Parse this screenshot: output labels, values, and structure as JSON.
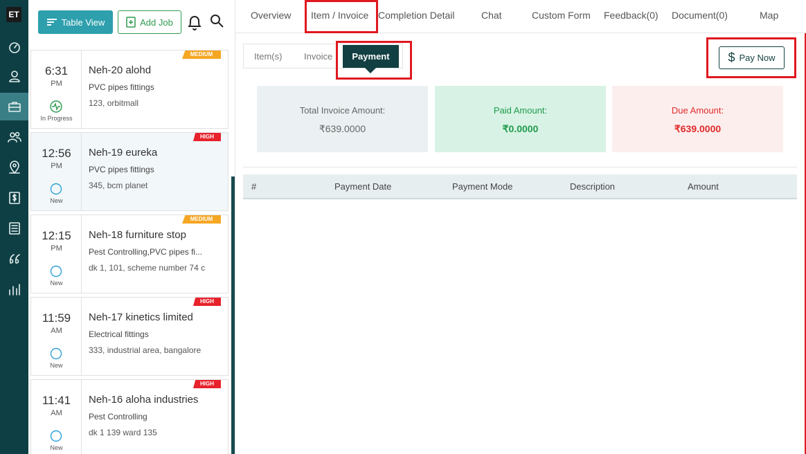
{
  "app": {
    "logo_text": "ET",
    "rail_icons": [
      "dashboard-icon",
      "user-icon",
      "briefcase-icon",
      "users-icon",
      "map-pin-icon",
      "dollar-icon",
      "list-icon",
      "quote-icon",
      "bar-chart-icon"
    ],
    "active_rail_icon": "briefcase-icon"
  },
  "toolbar": {
    "table_view_label": "Table View",
    "add_job_label": "Add Job"
  },
  "jobs": [
    {
      "time": "6:31",
      "ampm": "PM",
      "status": "In Progress",
      "status_icon": "activity-icon",
      "title": "Neh-20 alohd",
      "service": "PVC pipes fittings",
      "address": "123, orbitmall",
      "priority": "MEDIUM"
    },
    {
      "time": "12:56",
      "ampm": "PM",
      "status": "New",
      "status_icon": "circle-icon",
      "title": "Neh-19 eureka",
      "service": "PVC pipes fittings",
      "address": "345, bcm planet",
      "priority": "HIGH"
    },
    {
      "time": "12:15",
      "ampm": "PM",
      "status": "New",
      "status_icon": "circle-icon",
      "title": "Neh-18 furniture stop",
      "service": "Pest Controlling,PVC pipes fi...",
      "address": "dk 1, 101, scheme number 74 c",
      "priority": "MEDIUM"
    },
    {
      "time": "11:59",
      "ampm": "AM",
      "status": "New",
      "status_icon": "circle-icon",
      "title": "Neh-17 kinetics limited",
      "service": "Electrical fittings",
      "address": "333, industrial area, bangalore",
      "priority": "HIGH"
    },
    {
      "time": "11:41",
      "ampm": "AM",
      "status": "New",
      "status_icon": "circle-icon",
      "title": "Neh-16 aloha industries",
      "service": "Pest Controlling",
      "address": "dk 1 139 ward 135",
      "priority": "HIGH"
    }
  ],
  "tabs": [
    "Overview",
    "Item / Invoice",
    "Completion Detail",
    "Chat",
    "Custom Form",
    "Feedback(0)",
    "Document(0)",
    "Map"
  ],
  "active_tab": "Item / Invoice",
  "subtabs": [
    "Item(s)",
    "Invoice",
    "Payment"
  ],
  "active_subtab": "Payment",
  "pay_now_label": "Pay Now",
  "summary": {
    "total_label": "Total Invoice Amount:",
    "total_value": "₹639.0000",
    "paid_label": "Paid Amount:",
    "paid_value": "₹0.0000",
    "due_label": "Due Amount:",
    "due_value": "₹639.0000"
  },
  "payments_table": {
    "headers": [
      "#",
      "Payment Date",
      "Payment Mode",
      "Description",
      "Amount"
    ],
    "rows": []
  },
  "colors": {
    "rail": "#0e3f44",
    "accent_teal": "#2d9fad",
    "highlight_red": "#e0181f",
    "priority_medium": "#f5a623",
    "priority_high": "#e8222b"
  }
}
